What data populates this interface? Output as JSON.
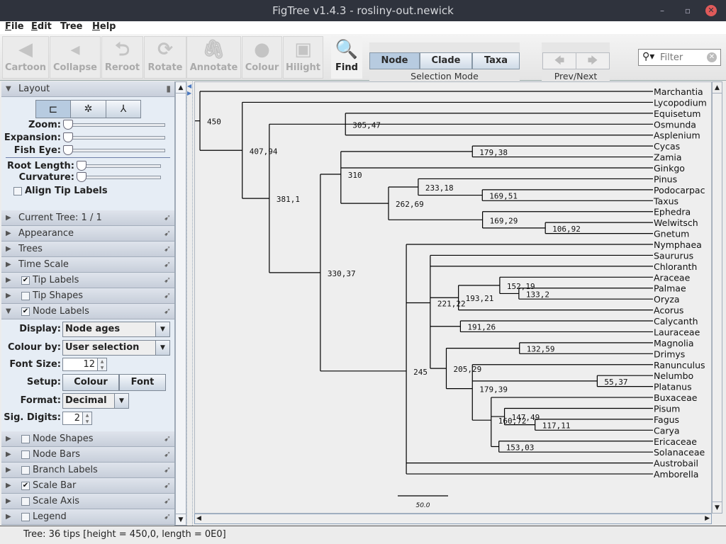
{
  "window": {
    "title": "FigTree v1.4.3 - rosliny-out.newick",
    "minimize": "–",
    "maximize": "▫",
    "close": "✕"
  },
  "menu": [
    {
      "key": "F",
      "rest": "ile"
    },
    {
      "key": "E",
      "rest": "dit"
    },
    {
      "key": "",
      "rest": "Tree"
    },
    {
      "key": "H",
      "rest": "elp"
    }
  ],
  "toolbar": {
    "buttons": [
      {
        "label": "Cartoon",
        "icon": "cartoon-icon",
        "enabled": false
      },
      {
        "label": "Collapse",
        "icon": "collapse-icon",
        "enabled": false
      },
      {
        "label": "Reroot",
        "icon": "reroot-icon",
        "enabled": false
      },
      {
        "label": "Rotate",
        "icon": "rotate-icon",
        "enabled": false
      },
      {
        "label": "Annotate",
        "icon": "paperclip-icon",
        "enabled": false
      },
      {
        "label": "Colour",
        "icon": "colour-ball-icon",
        "enabled": false
      },
      {
        "label": "Hilight",
        "icon": "hilight-icon",
        "enabled": false
      },
      {
        "label": "Find",
        "icon": "magnifier-icon",
        "enabled": true
      }
    ],
    "selection_mode": {
      "label": "Selection Mode",
      "options": [
        "Node",
        "Clade",
        "Taxa"
      ],
      "selected": "Node"
    },
    "prev_next": {
      "label": "Prev/Next",
      "prev": "🡄",
      "next": "🡆"
    },
    "filter": {
      "placeholder": "Filter"
    }
  },
  "left_panel": {
    "layout": {
      "title": "Layout",
      "zoom_label": "Zoom:",
      "expansion_label": "Expansion:",
      "fisheye_label": "Fish Eye:",
      "root_length_label": "Root Length:",
      "curvature_label": "Curvature:",
      "zoom": 0,
      "expansion": 0,
      "fisheye": 0,
      "root_length": 0,
      "curvature": 0,
      "align_tip_labels": {
        "label": "Align Tip Labels",
        "checked": false
      },
      "selected_layout": "rectangular"
    },
    "sections_top": [
      {
        "label": "Current Tree: 1 / 1"
      },
      {
        "label": "Appearance"
      },
      {
        "label": "Trees"
      },
      {
        "label": "Time Scale"
      },
      {
        "label": "Tip Labels",
        "checked": true
      },
      {
        "label": "Tip Shapes",
        "checked": false
      },
      {
        "label": "Node Labels",
        "checked": true,
        "expanded": true
      }
    ],
    "node_labels": {
      "display_label": "Display:",
      "display_value": "Node ages",
      "colour_by_label": "Colour by:",
      "colour_by_value": "User selection",
      "font_size_label": "Font Size:",
      "font_size": "12",
      "setup_label": "Setup:",
      "colour_button": "Colour",
      "font_button": "Font",
      "format_label": "Format:",
      "format_value": "Decimal",
      "sig_digits_label": "Sig. Digits:",
      "sig_digits": "2"
    },
    "sections_bottom": [
      {
        "label": "Node Shapes",
        "checked": false
      },
      {
        "label": "Node Bars",
        "checked": false
      },
      {
        "label": "Branch Labels",
        "checked": false
      },
      {
        "label": "Scale Bar",
        "checked": true
      },
      {
        "label": "Scale Axis",
        "checked": false
      },
      {
        "label": "Legend",
        "checked": false
      }
    ]
  },
  "tree": {
    "scale_bar": "50.0",
    "scale_bar_value": 50,
    "root": {
      "label": "450",
      "children": [
        "Marchantia",
        {
          "label": "407,94",
          "children": [
            "Lycopodium",
            {
              "label": "381,1",
              "children": [
                {
                  "label": "305,47",
                  "children": [
                    "Equisetum",
                    "Osmunda",
                    "Asplenium"
                  ]
                },
                {
                  "label": "330,37",
                  "children": [
                    {
                      "label": "310",
                      "children": [
                        {
                          "label": "179,38",
                          "children": [
                            "Cycas",
                            "Zamia"
                          ]
                        },
                        "Ginkgo",
                        {
                          "label": "262,69",
                          "children": [
                            {
                              "label": "233,18",
                              "children": [
                                "Pinus",
                                {
                                  "label": "169,51",
                                  "children": [
                                    "Podocarpac",
                                    "Taxus"
                                  ]
                                }
                              ]
                            },
                            {
                              "label": "169,29",
                              "children": [
                                "Ephedra",
                                {
                                  "label": "106,92",
                                  "children": [
                                    "Welwitsch",
                                    "Gnetum"
                                  ]
                                }
                              ]
                            }
                          ]
                        }
                      ]
                    },
                    {
                      "label": "245",
                      "children": [
                        "Nymphaea",
                        {
                          "label": "221,22",
                          "children": [
                            "Saururus",
                            "Chloranth",
                            {
                              "label": "193,21",
                              "children": [
                                {
                                  "label": "152,19",
                                  "children": [
                                    "Araceae",
                                    {
                                      "label": "133,2",
                                      "children": [
                                        "Palmae",
                                        "Oryza"
                                      ]
                                    }
                                  ]
                                },
                                "Acorus"
                              ]
                            },
                            {
                              "label": "191,26",
                              "children": [
                                "Calycanth",
                                "Lauraceae"
                              ]
                            },
                            {
                              "label": "205,29",
                              "children": [
                                {
                                  "label": "132,59",
                                  "children": [
                                    "Magnolia",
                                    "Drimys"
                                  ]
                                },
                                {
                                  "label": "179,39",
                                  "children": [
                                    "Ranunculus",
                                    {
                                      "label": "55,37",
                                      "children": [
                                        "Nelumbo",
                                        "Platanus"
                                      ]
                                    },
                                    {
                                      "label": "160,72",
                                      "children": [
                                        "Buxaceae",
                                        {
                                          "label": "147,49",
                                          "children": [
                                            "Pisum",
                                            {
                                              "label": "117,11",
                                              "children": [
                                                "Fagus",
                                                "Carya"
                                              ]
                                            }
                                          ]
                                        },
                                        {
                                          "label": "153,03",
                                          "children": [
                                            "Ericaceae",
                                            "Solanaceae"
                                          ]
                                        }
                                      ]
                                    }
                                  ]
                                }
                              ]
                            }
                          ]
                        },
                        "Austrobail",
                        "Amborella"
                      ]
                    }
                  ]
                }
              ]
            }
          ]
        }
      ]
    }
  },
  "status": "Tree: 36 tips [height = 450,0, length = 0E0]"
}
